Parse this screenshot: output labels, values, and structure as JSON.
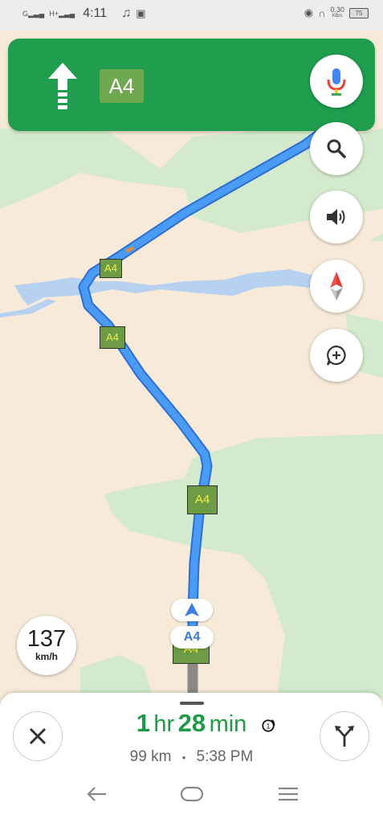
{
  "status_bar": {
    "signal1_label": "G",
    "signal2_label": "H+",
    "time": "4:11",
    "data_speed": "0.30",
    "data_speed_unit": "KB/s",
    "battery": "75"
  },
  "navigation": {
    "road_name": "A4",
    "direction": "straight"
  },
  "map": {
    "route_shields": [
      "A4",
      "A4",
      "A4",
      "A4"
    ],
    "road_chip": "A4"
  },
  "speedometer": {
    "value": "137",
    "unit": "km/h"
  },
  "trip": {
    "hours": "1",
    "hours_unit": "hr",
    "minutes": "28",
    "minutes_unit": "min",
    "distance": "99 km",
    "separator": "•",
    "arrival": "5:38 PM"
  },
  "colors": {
    "banner": "#1f9e4e",
    "route": "#3f8ef0",
    "eta": "#1e9b45"
  },
  "icons": [
    "arrow-up-icon",
    "mic-icon",
    "search-icon",
    "volume-icon",
    "compass-icon",
    "add-report-icon",
    "close-icon",
    "alternate-routes-icon",
    "incident-icon",
    "back-icon",
    "home-icon",
    "menu-icon"
  ]
}
